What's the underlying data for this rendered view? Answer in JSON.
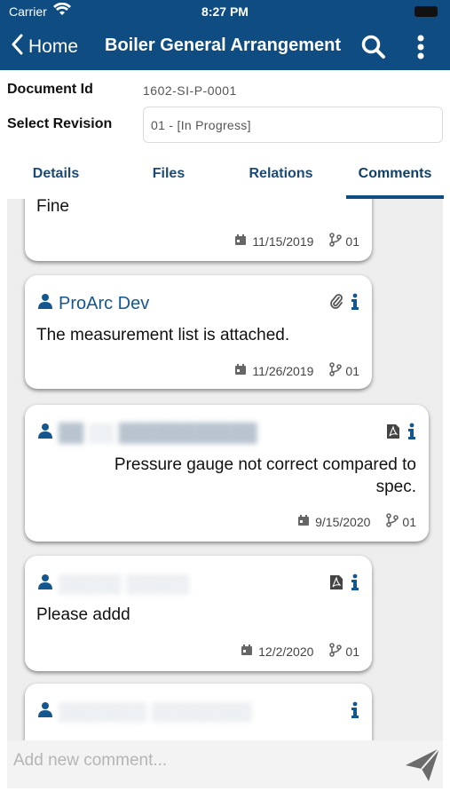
{
  "status_bar": {
    "carrier": "Carrier",
    "time": "8:27 PM"
  },
  "nav": {
    "back_label": "Home",
    "title": "Boiler General Arrangement"
  },
  "document": {
    "id_label": "Document Id",
    "id_value": "1602-SI-P-0001",
    "revision_label": "Select Revision",
    "revision_value": "01 - [In Progress]"
  },
  "tabs": [
    {
      "label": "Details",
      "active": false
    },
    {
      "label": "Files",
      "active": false
    },
    {
      "label": "Relations",
      "active": false
    },
    {
      "label": "Comments",
      "active": true
    }
  ],
  "comments": [
    {
      "author": "",
      "text": "Fine",
      "date": "11/15/2019",
      "revision": "01",
      "attachment": "none"
    },
    {
      "author": "ProArc Dev",
      "text": "The measurement list is attached.",
      "date": "11/26/2019",
      "revision": "01",
      "attachment": "paperclip"
    },
    {
      "author": "",
      "author_obscured": true,
      "text": "Pressure gauge not correct compared to spec.",
      "date": "9/15/2020",
      "revision": "01",
      "attachment": "pdf"
    },
    {
      "author": "",
      "author_obscured": true,
      "text": "Please addd",
      "date": "12/2/2020",
      "revision": "01",
      "attachment": "pdf"
    },
    {
      "author": "",
      "author_obscured": true,
      "text": "",
      "date": "",
      "revision": "",
      "attachment": "none"
    }
  ],
  "composer": {
    "placeholder": "Add new comment..."
  },
  "colors": {
    "brand": "#0f4c81",
    "link": "#14578f",
    "background": "#eeeeee"
  },
  "icons": [
    "wifi-icon",
    "back-chevron-icon",
    "search-icon",
    "more-vertical-icon",
    "user-icon",
    "paperclip-icon",
    "pdf-icon",
    "info-icon",
    "calendar-icon",
    "branch-icon",
    "send-icon"
  ]
}
